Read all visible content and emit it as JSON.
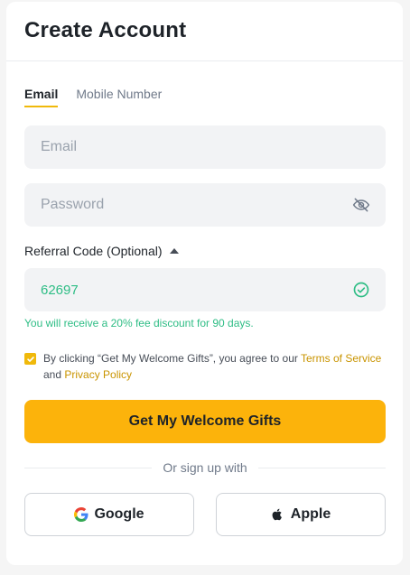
{
  "header": {
    "title": "Create Account"
  },
  "tabs": [
    {
      "label": "Email",
      "active": true
    },
    {
      "label": "Mobile Number",
      "active": false
    }
  ],
  "form": {
    "email": {
      "placeholder": "Email",
      "value": ""
    },
    "password": {
      "placeholder": "Password",
      "value": "",
      "toggle_icon": "eye-off-icon"
    },
    "referral": {
      "label": "Referral Code (Optional)",
      "expanded": true,
      "value": "62697",
      "status_icon": "check-circle-icon",
      "note": "You will receive a 20% fee discount for 90 days."
    },
    "agreement": {
      "checked": true,
      "text_prefix": "By clicking “Get My Welcome Gifts”, you agree to our ",
      "terms_link": "Terms of Service",
      "text_mid": " and ",
      "privacy_link": "Privacy Policy"
    },
    "submit_label": "Get My Welcome Gifts"
  },
  "social": {
    "divider_text": "Or sign up with",
    "google_label": "Google",
    "apple_label": "Apple"
  },
  "colors": {
    "accent": "#FCB30B",
    "success": "#2EBD85",
    "link": "#C99400"
  }
}
